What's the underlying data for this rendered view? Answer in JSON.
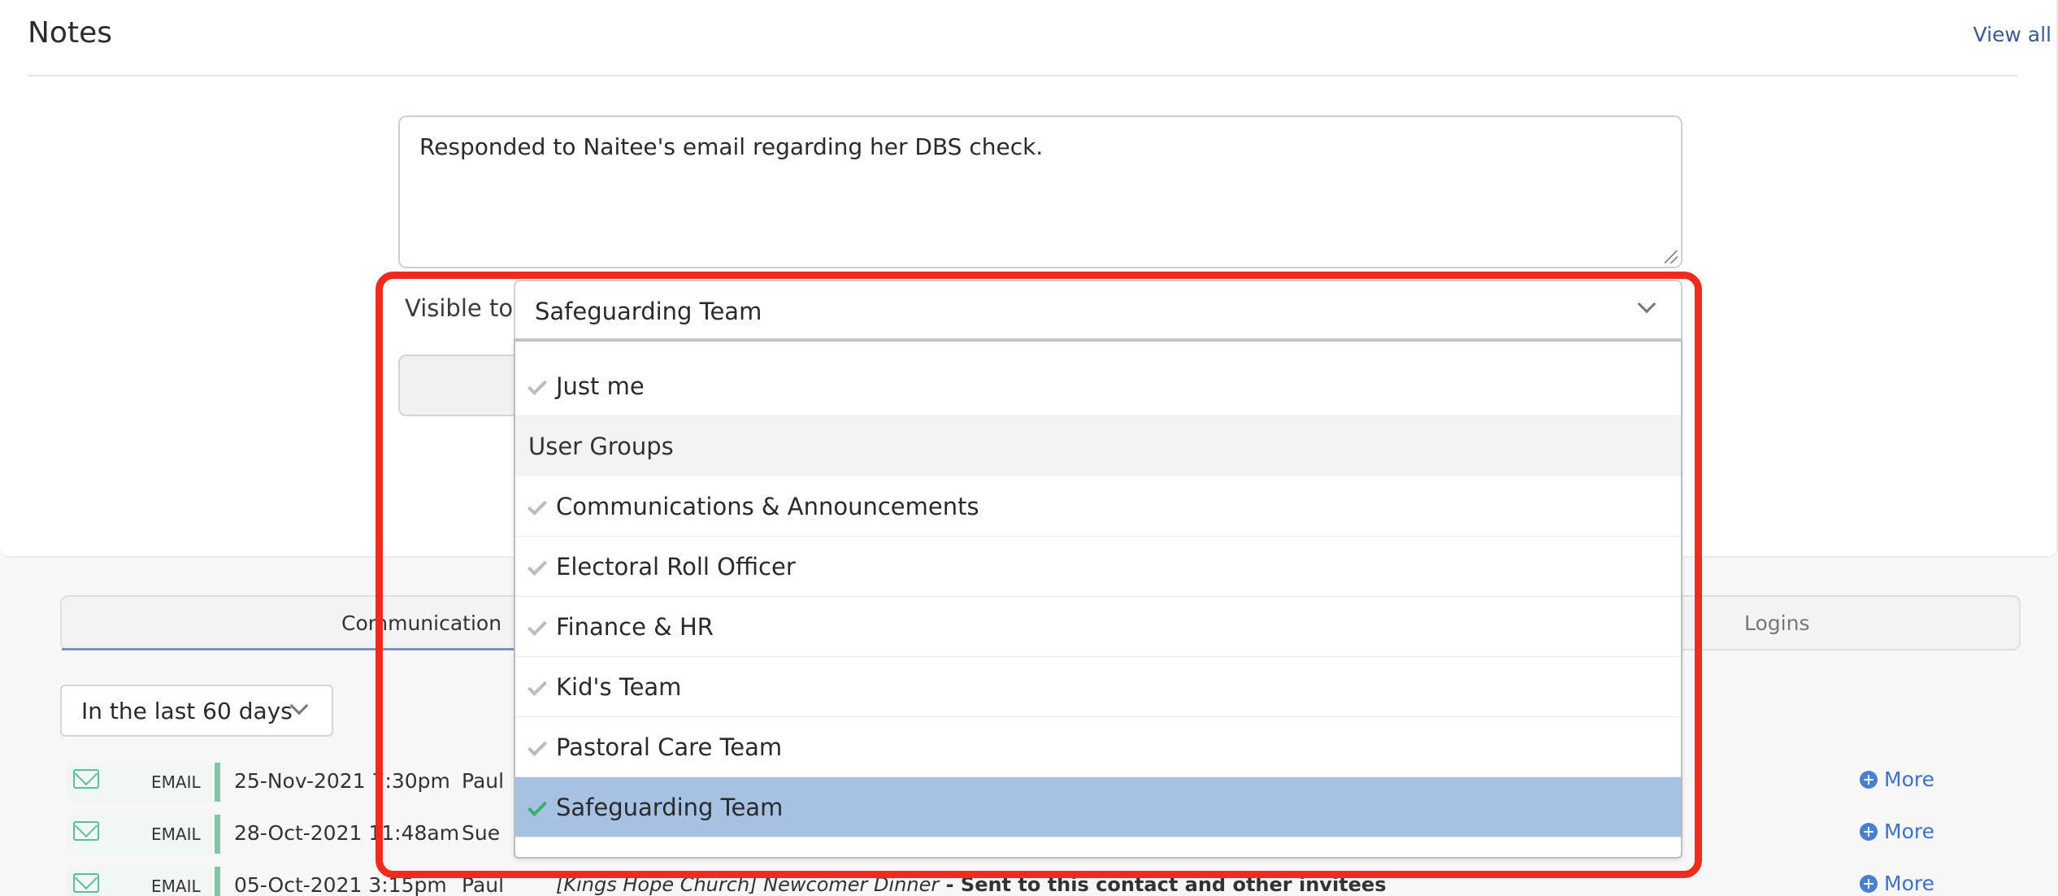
{
  "notes": {
    "title": "Notes",
    "view_all": "View all",
    "note_text": "Responded to Naitee's email regarding her DBS check.",
    "visible_to_label": "Visible to",
    "visible_to_value": "Safeguarding Team"
  },
  "dropdown": {
    "options_top": [
      {
        "label": "Just me"
      }
    ],
    "group_header": "User Groups",
    "group_options": [
      {
        "label": "Communications & Announcements"
      },
      {
        "label": "Electoral Roll Officer"
      },
      {
        "label": "Finance & HR"
      },
      {
        "label": "Kid's Team"
      },
      {
        "label": "Pastoral Care Team"
      },
      {
        "label": "Safeguarding Team",
        "selected": true
      }
    ]
  },
  "tabs": {
    "communication": "Communication",
    "logins": "Logins"
  },
  "filter": {
    "range": "In the last 60 days"
  },
  "communications": [
    {
      "type": "EMAIL",
      "date": "25-Nov-2021 7:30pm",
      "user": "Paul",
      "subject_italic": "",
      "subject_bold": "",
      "more": "More"
    },
    {
      "type": "EMAIL",
      "date": "28-Oct-2021 11:48am",
      "user": "Sue",
      "subject_italic": "",
      "subject_bold": "",
      "more": "More"
    },
    {
      "type": "EMAIL",
      "date": "05-Oct-2021 3:15pm",
      "user": "Paul",
      "subject_italic": "[Kings Hope Church] Newcomer Dinner",
      "subject_bold": " - Sent to this contact and other invitees",
      "more": "More"
    }
  ],
  "colors": {
    "highlight": "#f02a1d",
    "selected_option": "#a7c1e2",
    "email_accent": "#7fc7a6",
    "link": "#3d72c7"
  }
}
